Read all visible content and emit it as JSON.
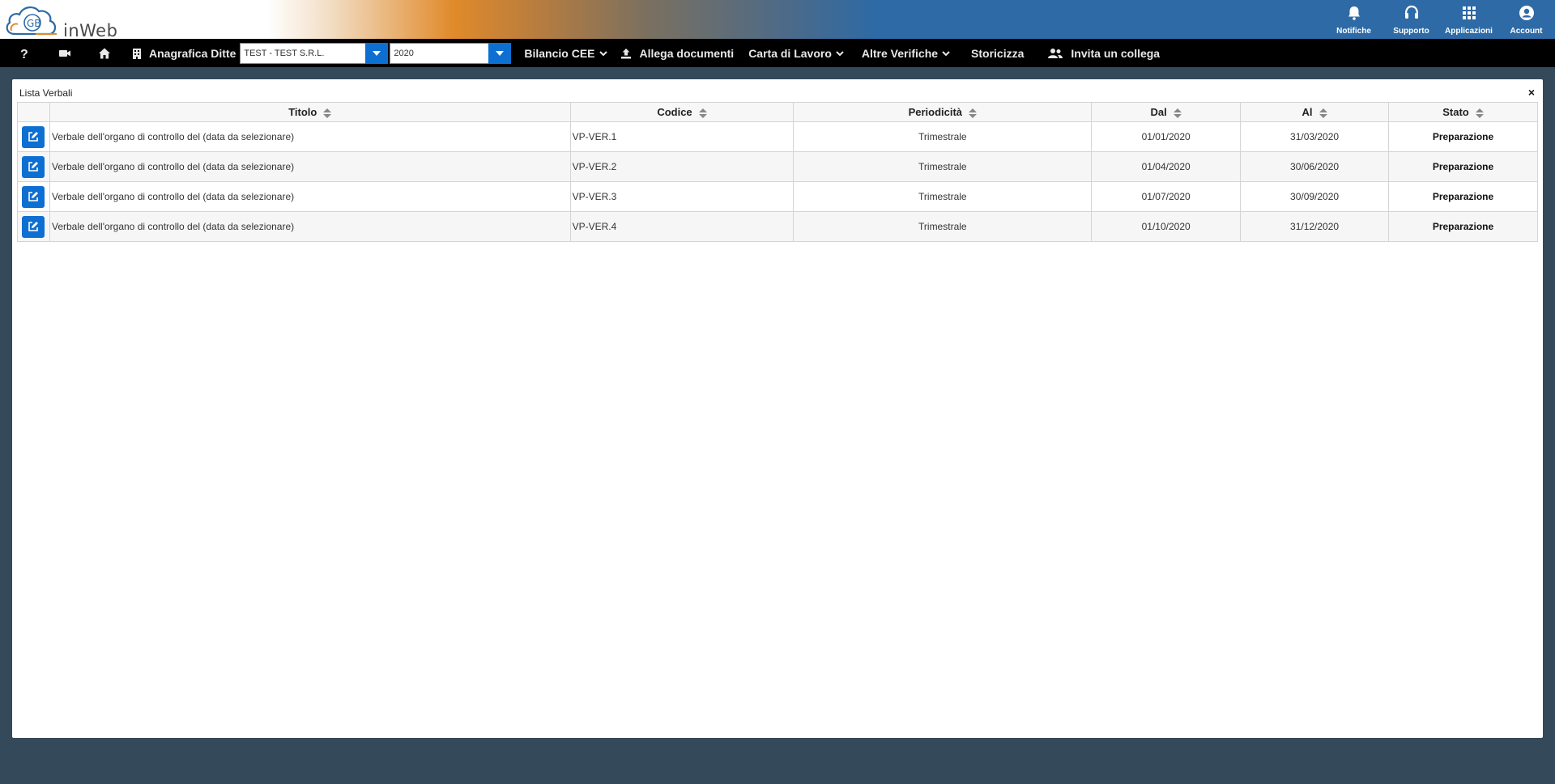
{
  "header": {
    "logo_text": "inWeb",
    "logo_mark": "GB",
    "actions": [
      {
        "label": "Notifiche",
        "icon": "bell-icon"
      },
      {
        "label": "Supporto",
        "icon": "headset-icon"
      },
      {
        "label": "Applicazioni",
        "icon": "grid-icon"
      },
      {
        "label": "Account",
        "icon": "account-icon"
      }
    ]
  },
  "toolbar": {
    "help_icon": "question-icon",
    "video_icon": "video-icon",
    "home_icon": "home-icon",
    "anagrafica_label": "Anagrafica Ditte",
    "company_value": "TEST - TEST S.R.L.",
    "year_value": "2020",
    "bilancio_label": "Bilancio CEE",
    "allega_label": "Allega documenti",
    "carta_label": "Carta di Lavoro",
    "altre_label": "Altre Verifiche",
    "storicizza_label": "Storicizza",
    "invita_label": "Invita un collega"
  },
  "panel": {
    "title": "Lista Verbali",
    "close_glyph": "×",
    "columns": [
      "Titolo",
      "Codice",
      "Periodicità",
      "Dal",
      "Al",
      "Stato"
    ],
    "rows": [
      {
        "titolo": "Verbale dell'organo di controllo del (data da selezionare)",
        "codice": "VP-VER.1",
        "periodicita": "Trimestrale",
        "dal": "01/01/2020",
        "al": "31/03/2020",
        "stato": "Preparazione"
      },
      {
        "titolo": "Verbale dell'organo di controllo del (data da selezionare)",
        "codice": "VP-VER.2",
        "periodicita": "Trimestrale",
        "dal": "01/04/2020",
        "al": "30/06/2020",
        "stato": "Preparazione"
      },
      {
        "titolo": "Verbale dell'organo di controllo del (data da selezionare)",
        "codice": "VP-VER.3",
        "periodicita": "Trimestrale",
        "dal": "01/07/2020",
        "al": "30/09/2020",
        "stato": "Preparazione"
      },
      {
        "titolo": "Verbale dell'organo di controllo del (data da selezionare)",
        "codice": "VP-VER.4",
        "periodicita": "Trimestrale",
        "dal": "01/10/2020",
        "al": "31/12/2020",
        "stato": "Preparazione"
      }
    ]
  },
  "colors": {
    "header_blue": "#2e6aa5",
    "accent_orange": "#e08a2a",
    "button_blue": "#0d6fd1",
    "toolbar_bg": "#000000",
    "page_bg": "#34495a"
  }
}
